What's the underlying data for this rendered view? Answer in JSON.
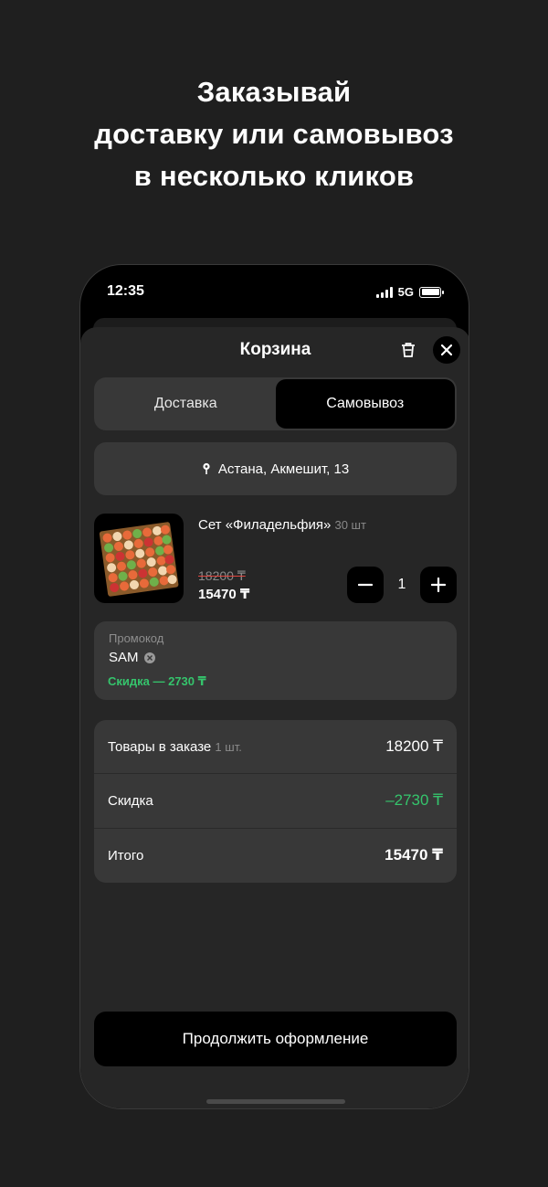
{
  "headline": {
    "line1": "Заказывай",
    "line2": "доставку или самовывоз",
    "line3": "в несколько кликов"
  },
  "status": {
    "time": "12:35",
    "network": "5G"
  },
  "cart": {
    "title": "Корзина",
    "tabs": [
      {
        "label": "Доставка",
        "active": false
      },
      {
        "label": "Самовывоз",
        "active": true
      }
    ],
    "address": "Астана, Акмешит, 13",
    "item": {
      "name": "Сет «Филадельфия»",
      "count": "30 шт",
      "old_price": "18200 ₸",
      "new_price": "15470 ₸",
      "quantity": "1"
    },
    "promo": {
      "label": "Промокод",
      "code": "SAM",
      "discount": "Скидка — 2730 ₸"
    },
    "summary": {
      "goods_label": "Товары в заказе",
      "goods_count": "1 шт.",
      "goods_value": "18200 ₸",
      "discount_label": "Скидка",
      "discount_value": "–2730 ₸",
      "total_label": "Итого",
      "total_value": "15470 ₸"
    },
    "continue_label": "Продолжить оформление"
  },
  "colors": {
    "accent_green": "#35c46c",
    "background": "#1f1f1f",
    "card": "#383838"
  }
}
